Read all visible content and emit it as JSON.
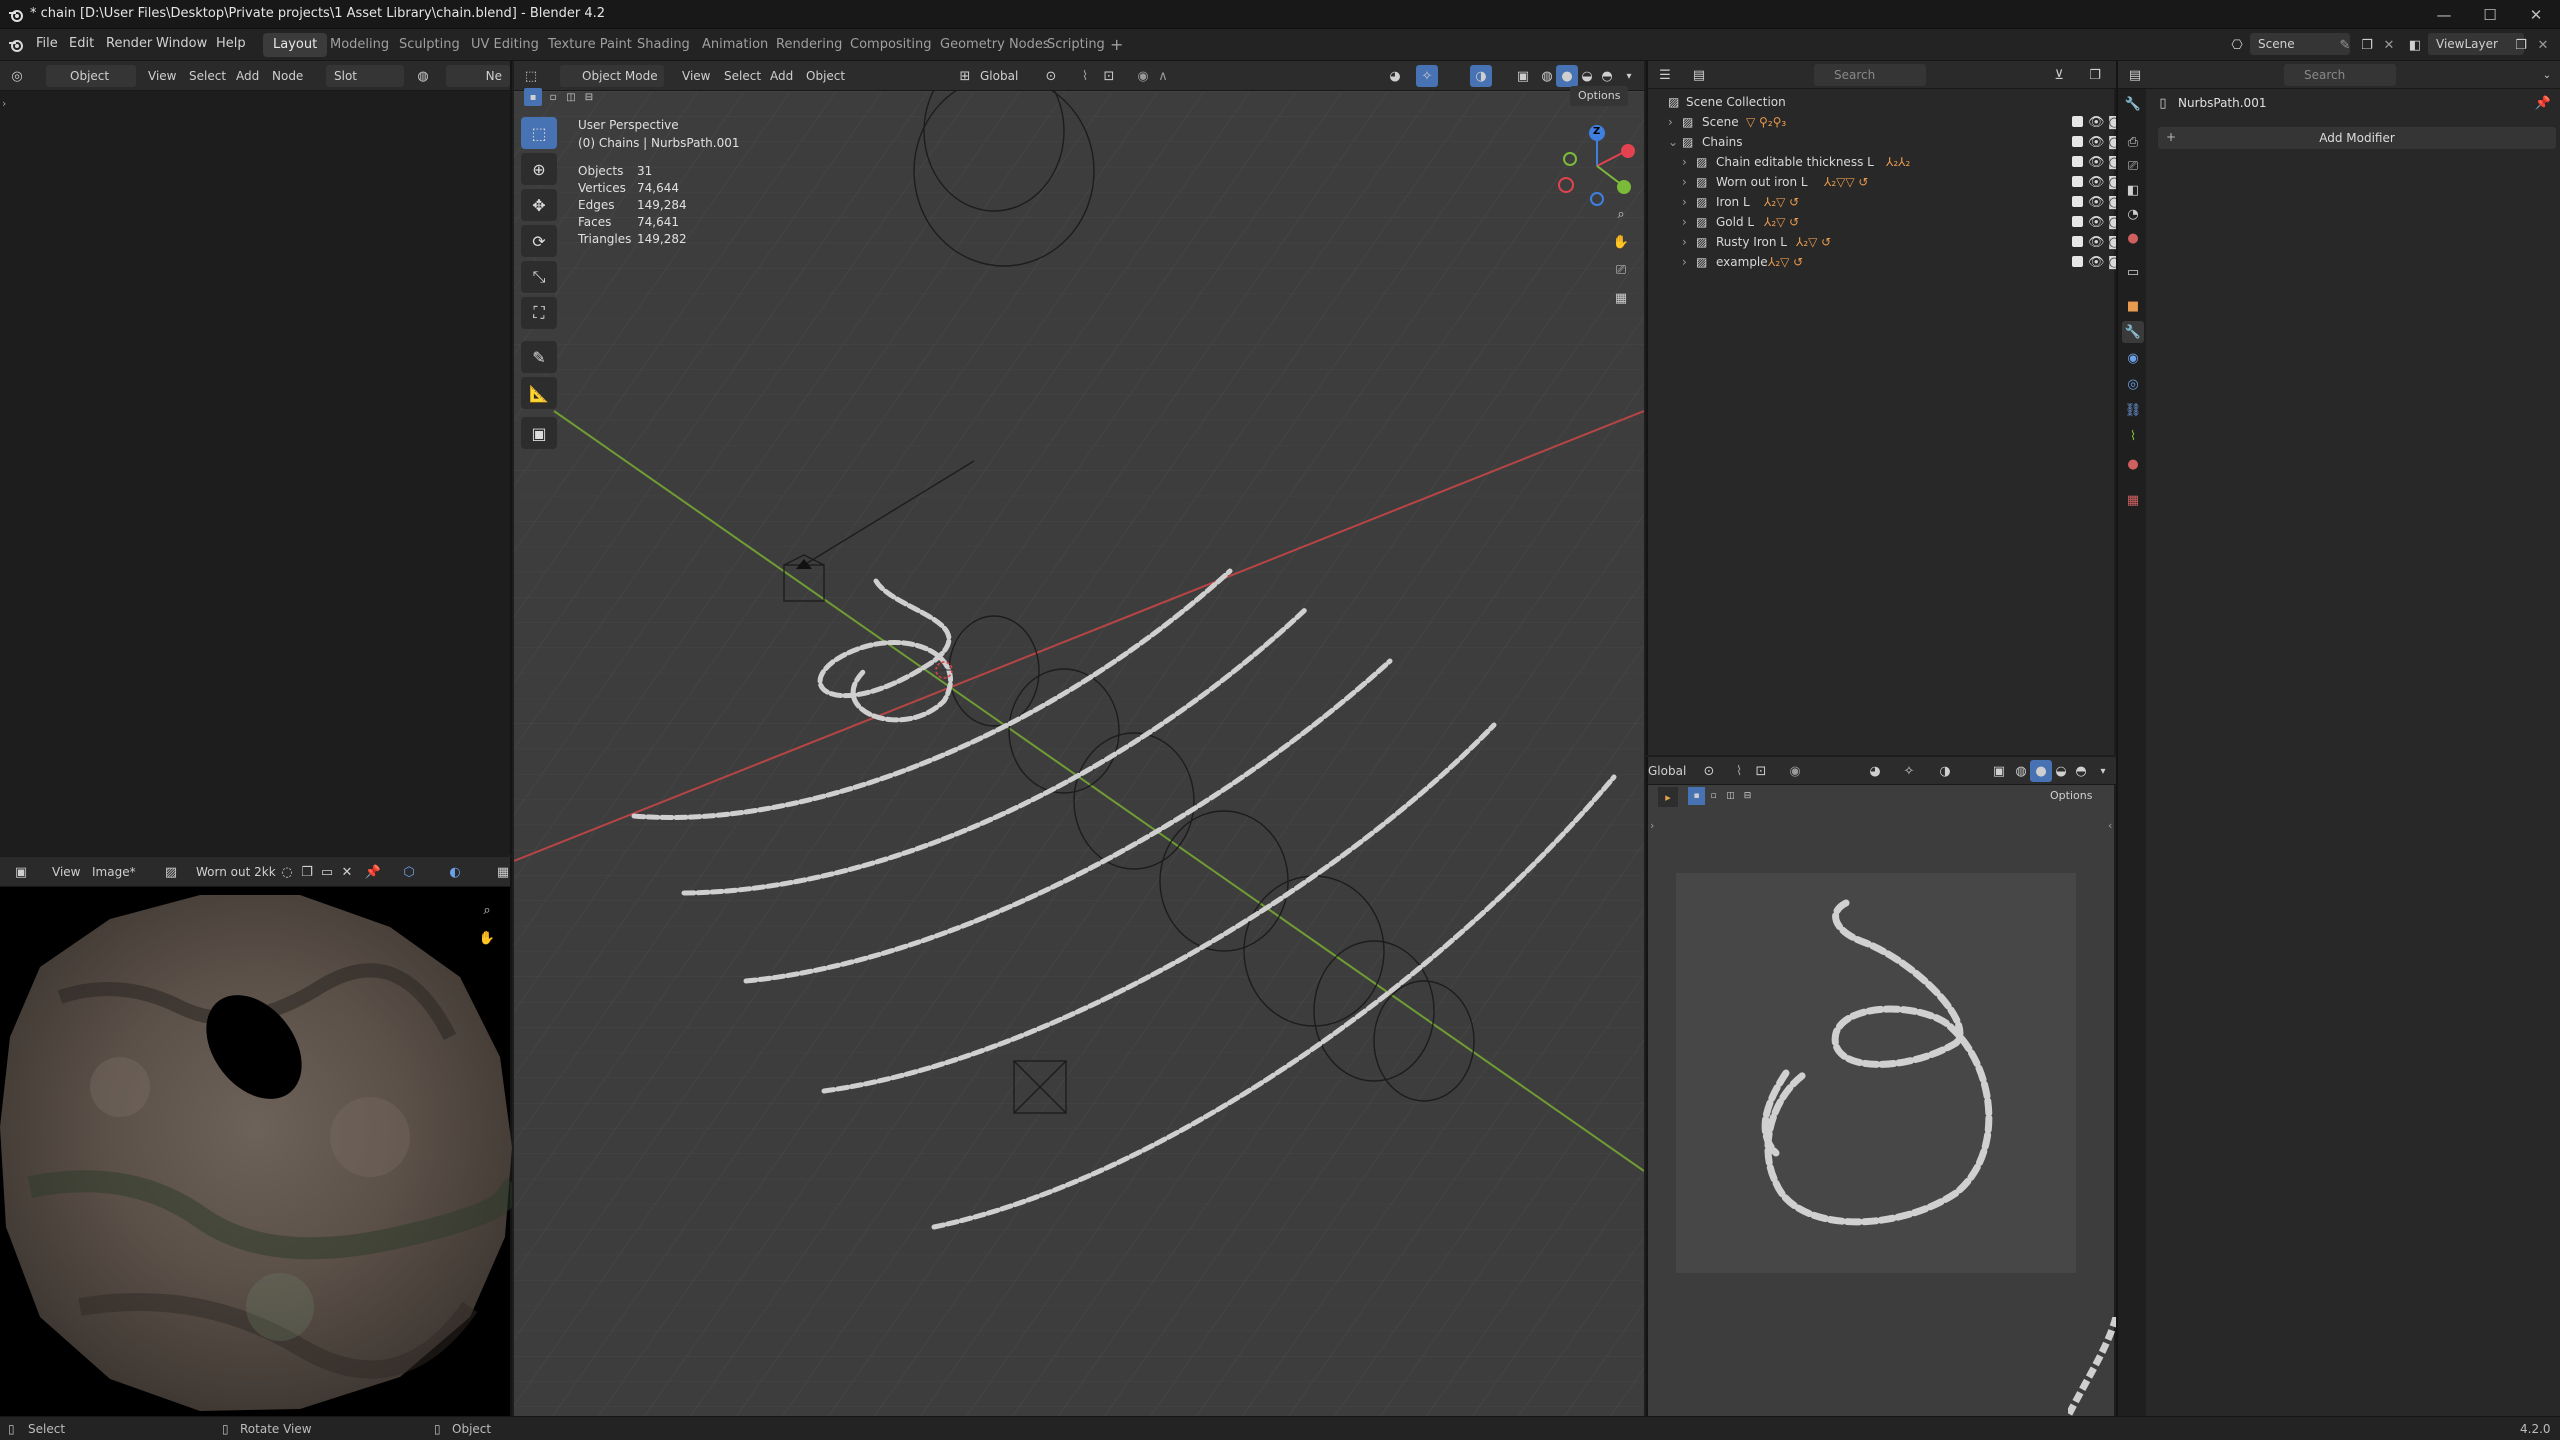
{
  "window": {
    "title": "* chain [D:\\User Files\\Desktop\\Private projects\\1 Asset Library\\chain.blend] - Blender 4.2",
    "minimize": "—",
    "maximize": "☐",
    "close": "✕"
  },
  "menu": [
    "File",
    "Edit",
    "Render",
    "Window",
    "Help"
  ],
  "workspaces": [
    "Layout",
    "Modeling",
    "Sculpting",
    "UV Editing",
    "Texture Paint",
    "Shading",
    "Animation",
    "Rendering",
    "Compositing",
    "Geometry Nodes",
    "Scripting"
  ],
  "active_workspace": "Layout",
  "scene": {
    "label": "Scene",
    "view_layer": "ViewLayer"
  },
  "node_editor": {
    "object_type": "Object",
    "menus": [
      "View",
      "Select",
      "Add",
      "Node"
    ],
    "slot": "Slot",
    "new_label": "Ne"
  },
  "viewport": {
    "mode": "Object Mode",
    "menus": [
      "View",
      "Select",
      "Add",
      "Object"
    ],
    "orientation": "Global",
    "options_label": "Options",
    "perspective": "User Perspective",
    "active": "(0) Chains | NurbsPath.001",
    "stats": [
      {
        "label": "Objects",
        "value": "31"
      },
      {
        "label": "Vertices",
        "value": "74,644"
      },
      {
        "label": "Edges",
        "value": "149,284"
      },
      {
        "label": "Faces",
        "value": "74,641"
      },
      {
        "label": "Triangles",
        "value": "149,282"
      }
    ],
    "gizmo_z": "Z"
  },
  "outliner": {
    "search_placeholder": "Search",
    "collection": "Scene Collection",
    "items": [
      {
        "name": "Scene",
        "level": 1,
        "expanded": false
      },
      {
        "name": "Chains",
        "level": 1,
        "expanded": true
      },
      {
        "name": "Chain editable thickness L",
        "level": 2
      },
      {
        "name": "Worn out iron L",
        "level": 2
      },
      {
        "name": "Iron L",
        "level": 2
      },
      {
        "name": "Gold L",
        "level": 2
      },
      {
        "name": "Rusty Iron L",
        "level": 2
      },
      {
        "name": "example",
        "level": 2
      }
    ]
  },
  "properties": {
    "search_placeholder": "Search",
    "object_name": "NurbsPath.001",
    "add_modifier": "Add Modifier"
  },
  "image_editor": {
    "menus": [
      "View",
      "Image*"
    ],
    "image_name": "Worn out 2kk"
  },
  "mini_viewport": {
    "orientation": "Global",
    "options_label": "Options"
  },
  "status": {
    "select": "Select",
    "rotate": "Rotate View",
    "object": "Object",
    "version": "4.2.0"
  },
  "colors": {
    "accent": "#4772b3",
    "object_orange": "#e89a4e",
    "axis_red": "#c24848",
    "axis_green": "#7aa03a",
    "gizmo_x": "#e2434e",
    "gizmo_y": "#7cba3a",
    "gizmo_z": "#3f7fe0"
  }
}
